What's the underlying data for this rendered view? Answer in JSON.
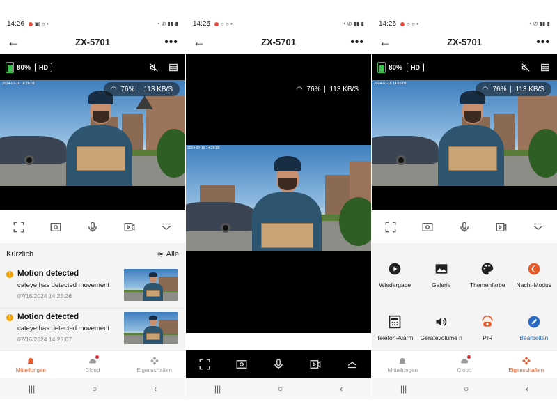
{
  "screens": [
    {
      "status": {
        "time": "14:26"
      },
      "header": {
        "title": "ZX-5701"
      },
      "video": {
        "battery": "80%",
        "quality": "HD",
        "signal": "76%",
        "rate": "113 KB/S",
        "stamp": "2024-07-16 14:26:03"
      },
      "recent": {
        "label": "Kürzlich",
        "all_label": "Alle",
        "events": [
          {
            "title": "Motion detected",
            "desc": "cateye has detected movement",
            "time": "07/16/2024 14:25:26"
          },
          {
            "title": "Motion detected",
            "desc": "cateye has detected movement",
            "time": "07/16/2024 14:25:07"
          }
        ]
      },
      "tabs": [
        "Mitteilungen",
        "Cloud",
        "Eigenschaften"
      ]
    },
    {
      "status": {
        "time": "14:25"
      },
      "header": {
        "title": "ZX-5701"
      },
      "video": {
        "signal": "76%",
        "rate": "113 KB/S",
        "stamp": "2024-07-16 14:26:03"
      }
    },
    {
      "status": {
        "time": "14:25"
      },
      "header": {
        "title": "ZX-5701"
      },
      "video": {
        "battery": "80%",
        "quality": "HD",
        "signal": "76%",
        "rate": "113 KB/S",
        "stamp": "2024-07-16 14:26:03"
      },
      "features": [
        "Wiedergabe",
        "Galerie",
        "Themenfarbe",
        "Nacht-Modus",
        "Telefon-Alarm",
        "Gerätevolume n",
        "PIR",
        "Bearbeiten"
      ],
      "tabs": [
        "Mitteilungen",
        "Cloud",
        "Eigenschaften"
      ]
    }
  ],
  "colors": {
    "accent": "#e85a2a",
    "battery": "#39c24a",
    "edit": "#2a6cc6"
  }
}
